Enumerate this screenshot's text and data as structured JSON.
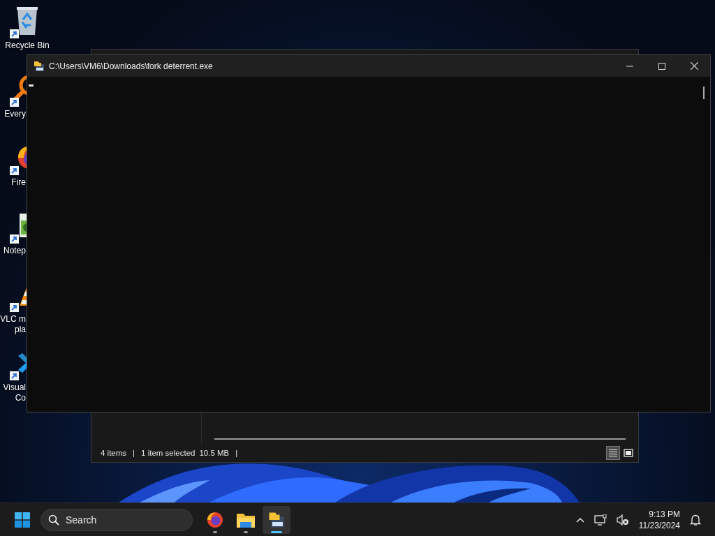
{
  "desktop_icons": [
    {
      "kind": "recycle-bin",
      "label_lines": [
        "Recycle Bin"
      ]
    },
    {
      "kind": "everything",
      "label_lines": [
        "Every"
      ]
    },
    {
      "kind": "firefox",
      "label_lines": [
        "Fire"
      ]
    },
    {
      "kind": "notepad",
      "label_lines": [
        "Notep"
      ]
    },
    {
      "kind": "vlc",
      "label_lines": [
        "VLC m",
        "pla"
      ]
    },
    {
      "kind": "vscode",
      "label_lines": [
        "Visual",
        "Co"
      ]
    }
  ],
  "explorer": {
    "status_parts": [
      "4 items",
      "|",
      "1 item selected",
      "10.5 MB",
      "|"
    ],
    "view_buttons": [
      {
        "kind": "details",
        "selected": true
      },
      {
        "kind": "tiles",
        "selected": false
      }
    ]
  },
  "console": {
    "title": "C:\\Users\\VM6\\Downloads\\fork deterrent.exe"
  },
  "taskbar": {
    "search": {
      "placeholder": "Search"
    },
    "apps": [
      {
        "kind": "firefox",
        "running": true,
        "active": false
      },
      {
        "kind": "explorer",
        "running": true,
        "active": false
      },
      {
        "kind": "console",
        "running": true,
        "active": true
      }
    ],
    "clock": {
      "time": "9:13 PM",
      "date": "11/23/2024"
    }
  }
}
